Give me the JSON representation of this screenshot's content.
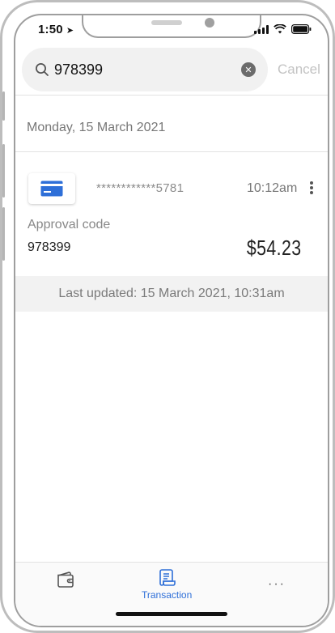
{
  "status_bar": {
    "time": "1:50"
  },
  "search": {
    "query": "978399",
    "cancel_label": "Cancel"
  },
  "section": {
    "date": "Monday, 15 March 2021"
  },
  "transaction": {
    "card_number": "************5781",
    "time": "10:12am",
    "approval_label": "Approval code",
    "approval_code": "978399",
    "amount": "$54.23"
  },
  "footer": {
    "last_updated": "Last updated: 15 March 2021, 10:31am"
  },
  "tabbar": {
    "items": [
      {
        "label": "",
        "icon": "wallet-icon"
      },
      {
        "label": "Transaction",
        "icon": "receipt-icon",
        "active": true
      },
      {
        "label": "",
        "icon": "more-horizontal-icon"
      }
    ]
  },
  "colors": {
    "accent": "#2e6fd8"
  }
}
